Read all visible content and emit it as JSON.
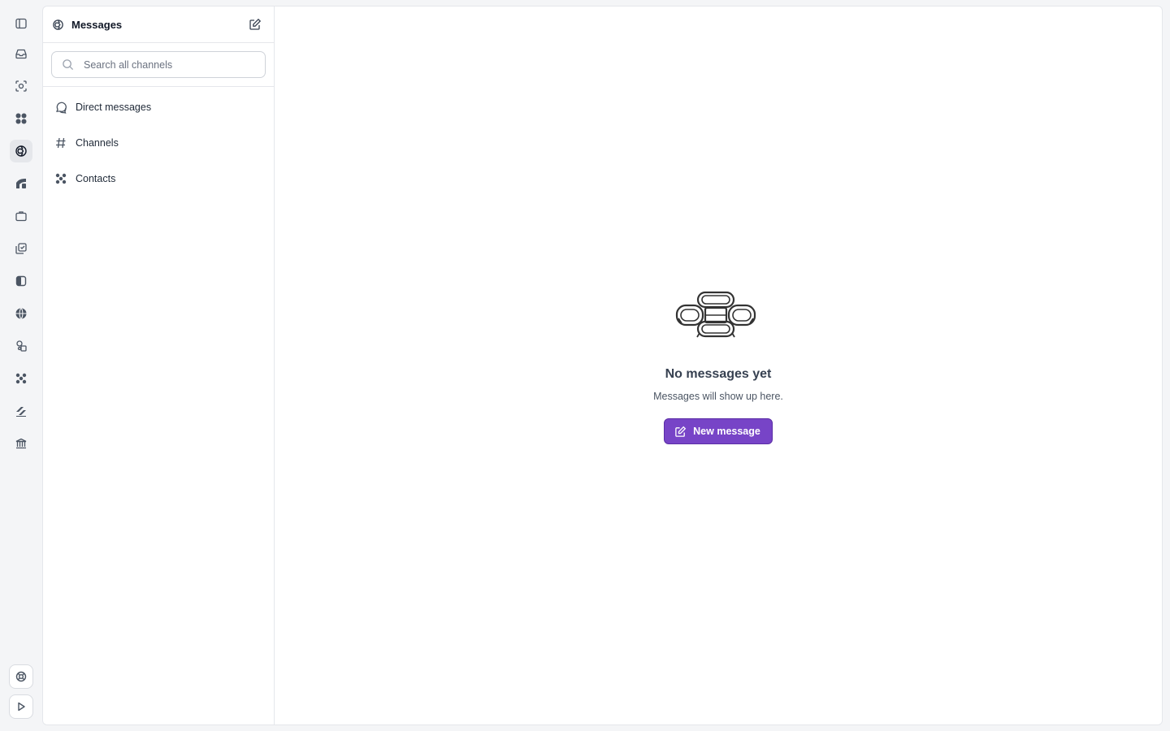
{
  "rail": {
    "items": [
      {
        "icon": "sidebar-toggle-icon"
      },
      {
        "icon": "inbox-icon"
      },
      {
        "icon": "scan-icon"
      },
      {
        "icon": "apps-grid-icon"
      },
      {
        "icon": "messages-icon",
        "active": true
      },
      {
        "icon": "chart-area-icon"
      },
      {
        "icon": "briefcase-icon"
      },
      {
        "icon": "tasks-icon"
      },
      {
        "icon": "panel-icon"
      },
      {
        "icon": "globe-icon"
      },
      {
        "icon": "shapes-icon"
      },
      {
        "icon": "dots-cluster-icon"
      },
      {
        "icon": "stripes-icon"
      },
      {
        "icon": "bank-icon"
      }
    ],
    "bottom": [
      {
        "icon": "help-icon"
      },
      {
        "icon": "play-icon"
      }
    ]
  },
  "sidebar": {
    "title": "Messages",
    "search_placeholder": "Search all channels",
    "nav": [
      {
        "label": "Direct messages",
        "icon": "chat-bubble-icon"
      },
      {
        "label": "Channels",
        "icon": "hash-icon"
      },
      {
        "label": "Contacts",
        "icon": "contacts-icon"
      }
    ]
  },
  "empty_state": {
    "title": "No messages yet",
    "subtitle": "Messages will show up here.",
    "button_label": "New message"
  },
  "colors": {
    "accent": "#7744c7",
    "background": "#f4f5f7",
    "surface": "#ffffff",
    "border": "#e5e7eb"
  }
}
